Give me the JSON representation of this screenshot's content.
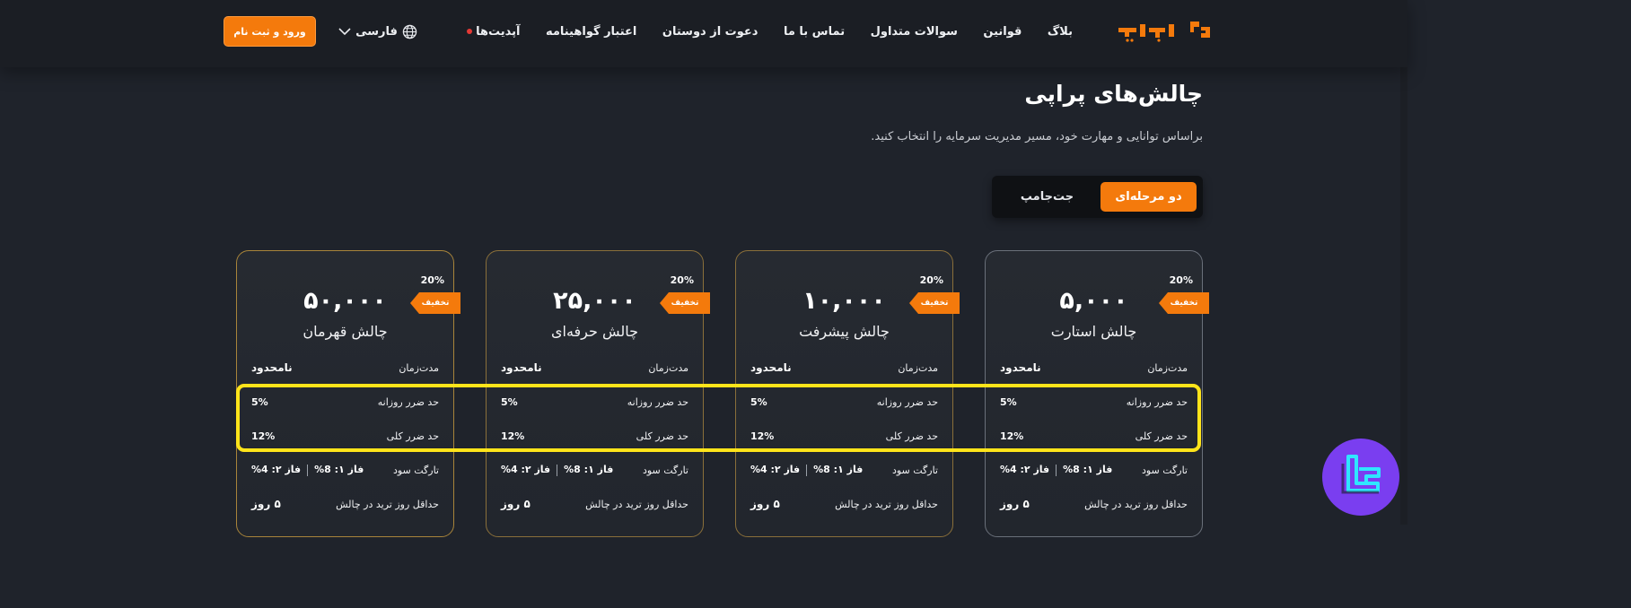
{
  "nav": {
    "logo_text": "پراپی",
    "items": [
      {
        "label": "بلاگ"
      },
      {
        "label": "قوانین"
      },
      {
        "label": "سوالات متداول"
      },
      {
        "label": "تماس با ما"
      },
      {
        "label": "دعوت از دوستان"
      },
      {
        "label": "اعتبار گواهینامه"
      },
      {
        "label": "آپدیت‌ها"
      }
    ],
    "language": "فارسی",
    "login_label": "ورود و ثبت نام"
  },
  "header": {
    "title": "چالش‌های پراپی",
    "subtitle": "براساس توانایی و مهارت خود، مسیر مدیریت سرمایه را انتخاب کنید."
  },
  "toggle": {
    "active_label": "دو مرحله‌ای",
    "inactive_label": "جت‌جامپ"
  },
  "cards": [
    {
      "discount_pct": "20%",
      "discount_label": "تخفیف",
      "amount": "۵,۰۰۰",
      "name": "چالش استارت",
      "duration_label": "مدت‌زمان",
      "duration": "نامحدود",
      "daily_loss_label": "حد ضرر روزانه",
      "daily_loss": "5%",
      "total_loss_label": "حد ضرر کلی",
      "total_loss": "12%",
      "target_label": "تارگت سود",
      "phase1": "فاز ۱: 8%",
      "phase2": "فاز ۲: 4%",
      "min_days_label": "حداقل روز ترید در چالش",
      "min_days": "۵ روز"
    },
    {
      "discount_pct": "20%",
      "discount_label": "تخفیف",
      "amount": "۱۰,۰۰۰",
      "name": "چالش پیشرفت",
      "duration_label": "مدت‌زمان",
      "duration": "نامحدود",
      "daily_loss_label": "حد ضرر روزانه",
      "daily_loss": "5%",
      "total_loss_label": "حد ضرر کلی",
      "total_loss": "12%",
      "target_label": "تارگت سود",
      "phase1": "فاز ۱: 8%",
      "phase2": "فاز ۲: 4%",
      "min_days_label": "حداقل روز ترید در چالش",
      "min_days": "۵ روز"
    },
    {
      "discount_pct": "20%",
      "discount_label": "تخفیف",
      "amount": "۲۵,۰۰۰",
      "name": "چالش حرفه‌ای",
      "duration_label": "مدت‌زمان",
      "duration": "نامحدود",
      "daily_loss_label": "حد ضرر روزانه",
      "daily_loss": "5%",
      "total_loss_label": "حد ضرر کلی",
      "total_loss": "12%",
      "target_label": "تارگت سود",
      "phase1": "فاز ۱: 8%",
      "phase2": "فاز ۲: 4%",
      "min_days_label": "حداقل روز ترید در چالش",
      "min_days": "۵ روز"
    },
    {
      "discount_pct": "20%",
      "discount_label": "تخفیف",
      "amount": "۵۰,۰۰۰",
      "name": "چالش قهرمان",
      "duration_label": "مدت‌زمان",
      "duration": "نامحدود",
      "daily_loss_label": "حد ضرر روزانه",
      "daily_loss": "5%",
      "total_loss_label": "حد ضرر کلی",
      "total_loss": "12%",
      "target_label": "تارگت سود",
      "phase1": "فاز ۱: 8%",
      "phase2": "فاز ۲: 4%",
      "min_days_label": "حداقل روز ترید در چالش",
      "min_days": "۵ روز"
    }
  ],
  "colors": {
    "accent": "#f47a0c",
    "background": "#1f232b",
    "highlight": "#ffe41a",
    "badge": "#7a3ef0"
  },
  "icons": {
    "globe": "globe-icon",
    "chevron": "chevron-down-icon",
    "logo": "logo-icon",
    "badge": "watermark-badge-icon"
  }
}
